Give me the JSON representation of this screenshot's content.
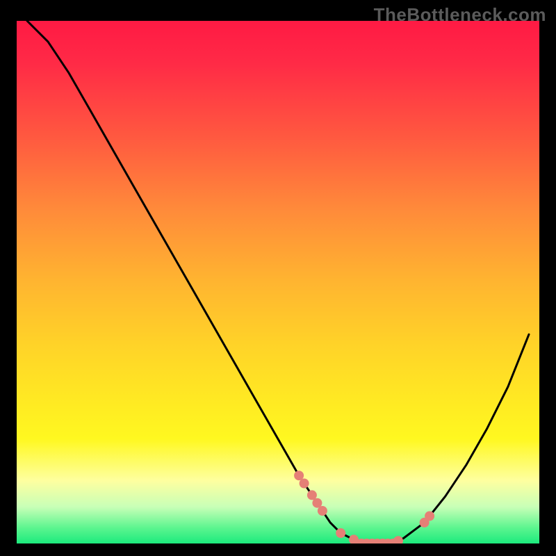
{
  "watermark": "TheBottleneck.com",
  "colors": {
    "curve": "#000000",
    "dot": "#e58076",
    "gradient_top": "#ff1a44",
    "gradient_bottom": "#1cea7d"
  },
  "chart_data": {
    "type": "line",
    "title": "",
    "xlabel": "",
    "ylabel": "",
    "xlim": [
      0,
      100
    ],
    "ylim": [
      0,
      100
    ],
    "grid": false,
    "note": "y ≈ bottleneck percentage (0 = optimal at valley floor, 100 = severe at top). x is relative hardware balance axis. Values read from the curve shape.",
    "series": [
      {
        "name": "bottleneck_curve",
        "x": [
          2,
          6,
          10,
          14,
          18,
          22,
          26,
          30,
          34,
          38,
          42,
          46,
          50,
          54,
          58,
          60,
          62,
          64,
          66,
          68,
          70,
          72,
          74,
          78,
          82,
          86,
          90,
          94,
          98
        ],
        "y": [
          100,
          96,
          90,
          83,
          76,
          69,
          62,
          55,
          48,
          41,
          34,
          27,
          20,
          13,
          7,
          4,
          2,
          1,
          0,
          0,
          0,
          0,
          1,
          4,
          9,
          15,
          22,
          30,
          40
        ]
      }
    ],
    "dots": {
      "note": "Highlighted sample markers along the curve (approximate x positions on 0–100 axis).",
      "x": [
        54,
        55,
        56.5,
        57.5,
        58.5,
        62,
        64.5,
        66,
        67,
        68,
        69,
        70,
        71,
        72,
        73,
        78,
        79
      ]
    }
  }
}
